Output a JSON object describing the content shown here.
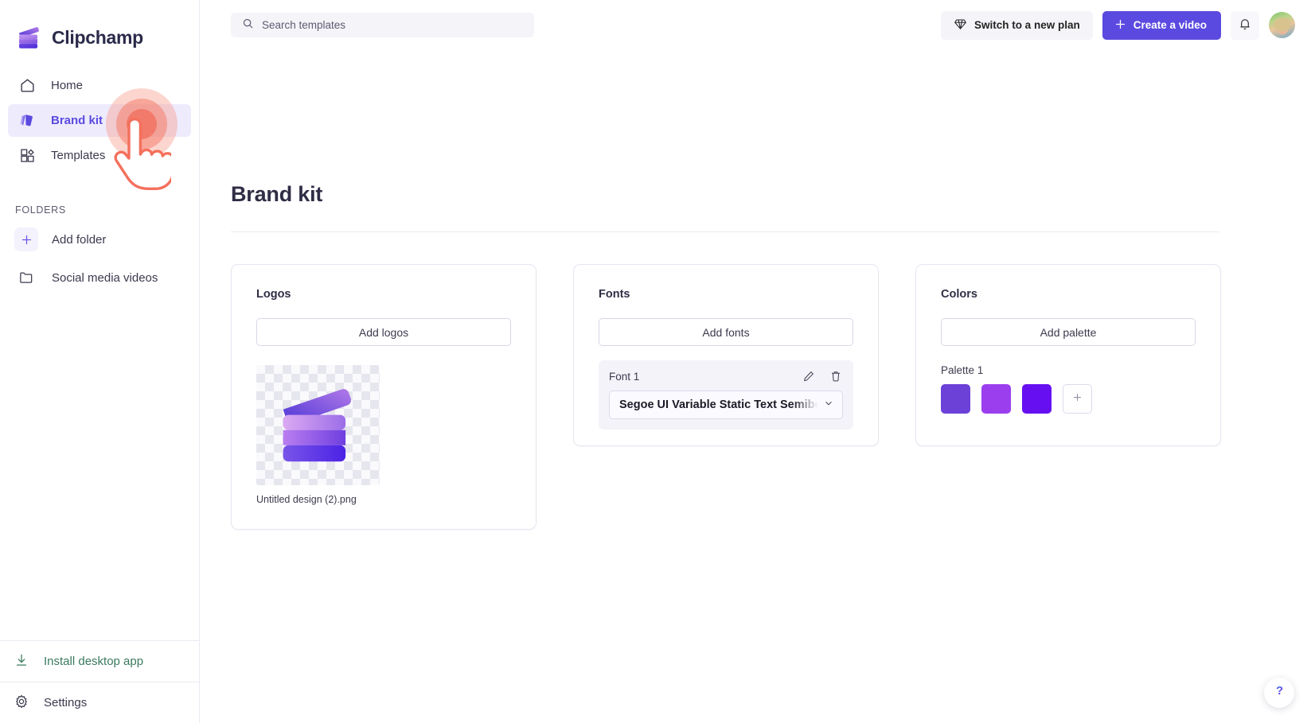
{
  "app": {
    "name": "Clipchamp",
    "logo_icon": "clapperboard-logo-icon"
  },
  "sidebar": {
    "nav": [
      {
        "label": "Home",
        "icon": "home-icon",
        "active": false
      },
      {
        "label": "Brand kit",
        "icon": "brand-kit-icon",
        "active": true
      },
      {
        "label": "Templates",
        "icon": "templates-grid-icon",
        "active": false
      }
    ],
    "folders_heading": "FOLDERS",
    "folders": [
      {
        "label": "Add folder",
        "icon": "plus-icon"
      },
      {
        "label": "Social media videos",
        "icon": "folder-icon"
      }
    ],
    "bottom": [
      {
        "label": "Install desktop app",
        "icon": "download-icon",
        "color": "#3a7a5e"
      },
      {
        "label": "Settings",
        "icon": "gear-icon",
        "color": "#3b3a4d"
      }
    ]
  },
  "topbar": {
    "search_placeholder": "Search templates",
    "search_value": "",
    "search_icon": "search-icon",
    "plan_button": "Switch to a new plan",
    "plan_icon": "diamond-icon",
    "create_button": "Create a video",
    "create_icon": "plus-icon",
    "notifications_icon": "bell-icon",
    "avatar_label": "avatar"
  },
  "page": {
    "title": "Brand kit"
  },
  "cards": {
    "logos": {
      "title": "Logos",
      "add_button": "Add logos",
      "items": [
        {
          "filename": "Untitled design (2).png",
          "thumbnail": "clapperboard-logo-image"
        }
      ]
    },
    "fonts": {
      "title": "Fonts",
      "add_button": "Add fonts",
      "items": [
        {
          "label": "Font 1",
          "value": "Segoe UI Variable Static Text Semibold",
          "edit_icon": "pencil-icon",
          "delete_icon": "trash-icon",
          "chevron_icon": "chevron-down-icon"
        }
      ]
    },
    "colors": {
      "title": "Colors",
      "add_button": "Add palette",
      "palettes": [
        {
          "label": "Palette 1",
          "swatches": [
            "#6B41D8",
            "#9B3FEE",
            "#6610F2"
          ],
          "add_swatch_icon": "plus-icon"
        }
      ]
    }
  },
  "help": {
    "icon": "question-mark-icon",
    "label": "Help"
  },
  "cursor": {
    "type": "pointing-hand-click",
    "color": "#f26d5b"
  },
  "theme": {
    "accent": "#5b4ae0",
    "active_nav_bg": "#eeebfc",
    "green": "#3a7a5e"
  }
}
